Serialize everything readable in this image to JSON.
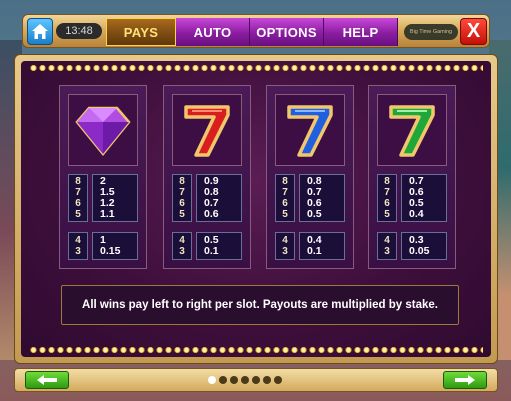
{
  "header": {
    "time": "13:48",
    "tabs": [
      {
        "label": "PAYS",
        "active": true
      },
      {
        "label": "AUTO",
        "active": false
      },
      {
        "label": "OPTIONS",
        "active": false
      },
      {
        "label": "HELP",
        "active": false
      }
    ],
    "brand": "Big Time Gaming",
    "close_label": "X"
  },
  "paytable": {
    "cards": [
      {
        "symbol": "purple-diamond",
        "rows_high": [
          "8",
          "7",
          "6",
          "5"
        ],
        "pays_high": [
          "2",
          "1.5",
          "1.2",
          "1.1"
        ],
        "rows_low": [
          "4",
          "3"
        ],
        "pays_low": [
          "1",
          "0.15"
        ]
      },
      {
        "symbol": "red-seven",
        "rows_high": [
          "8",
          "7",
          "6",
          "5"
        ],
        "pays_high": [
          "0.9",
          "0.8",
          "0.7",
          "0.6"
        ],
        "rows_low": [
          "4",
          "3"
        ],
        "pays_low": [
          "0.5",
          "0.1"
        ]
      },
      {
        "symbol": "blue-seven",
        "rows_high": [
          "8",
          "7",
          "6",
          "5"
        ],
        "pays_high": [
          "0.8",
          "0.7",
          "0.6",
          "0.5"
        ],
        "rows_low": [
          "4",
          "3"
        ],
        "pays_low": [
          "0.4",
          "0.1"
        ]
      },
      {
        "symbol": "green-seven",
        "rows_high": [
          "8",
          "7",
          "6",
          "5"
        ],
        "pays_high": [
          "0.7",
          "0.6",
          "0.5",
          "0.4"
        ],
        "rows_low": [
          "4",
          "3"
        ],
        "pays_low": [
          "0.3",
          "0.05"
        ]
      }
    ],
    "info": "All wins pay left to right per slot. Payouts are multiplied by stake."
  },
  "pager": {
    "page_count": 7,
    "current_page": 1
  },
  "colors": {
    "active_tab_text": "#ffe37a",
    "tab_bg": "#8a1ca0",
    "panel_bg": "#3e0f3c",
    "nav_green": "#2f9a12",
    "close_red": "#c31008"
  }
}
